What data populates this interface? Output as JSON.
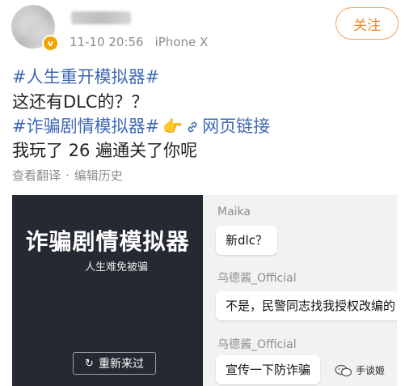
{
  "post": {
    "meta_time": "11-10 20:56",
    "meta_device": "iPhone X",
    "follow_label": "关注",
    "tag1": "#人生重开模拟器#",
    "line2": "这还有DLC的？？",
    "tag2": "#诈骗剧情模拟器#",
    "hand_emoji": "👉",
    "link_label": "网页链接",
    "line4": "我玩了 26 遍通关了你呢",
    "translate_label": "查看翻译",
    "separator": "·",
    "history_label": "编辑历史"
  },
  "game": {
    "title": "诈骗剧情模拟器",
    "subtitle": "人生难免被骗",
    "restart_label": "重新来过"
  },
  "chat": {
    "messages": [
      {
        "name": "Maika",
        "text": "新dlc？"
      },
      {
        "name": "乌德酱_Official",
        "text": "不是，民警同志找我授权改编的"
      },
      {
        "name": "乌德酱_Official",
        "text": "宣传一下防诈骗"
      }
    ]
  },
  "watermark": "手谈姬",
  "colors": {
    "link": "#3f69b5",
    "follow": "#f08a28",
    "game_bg": "#252932",
    "vip": "#f4a400"
  }
}
